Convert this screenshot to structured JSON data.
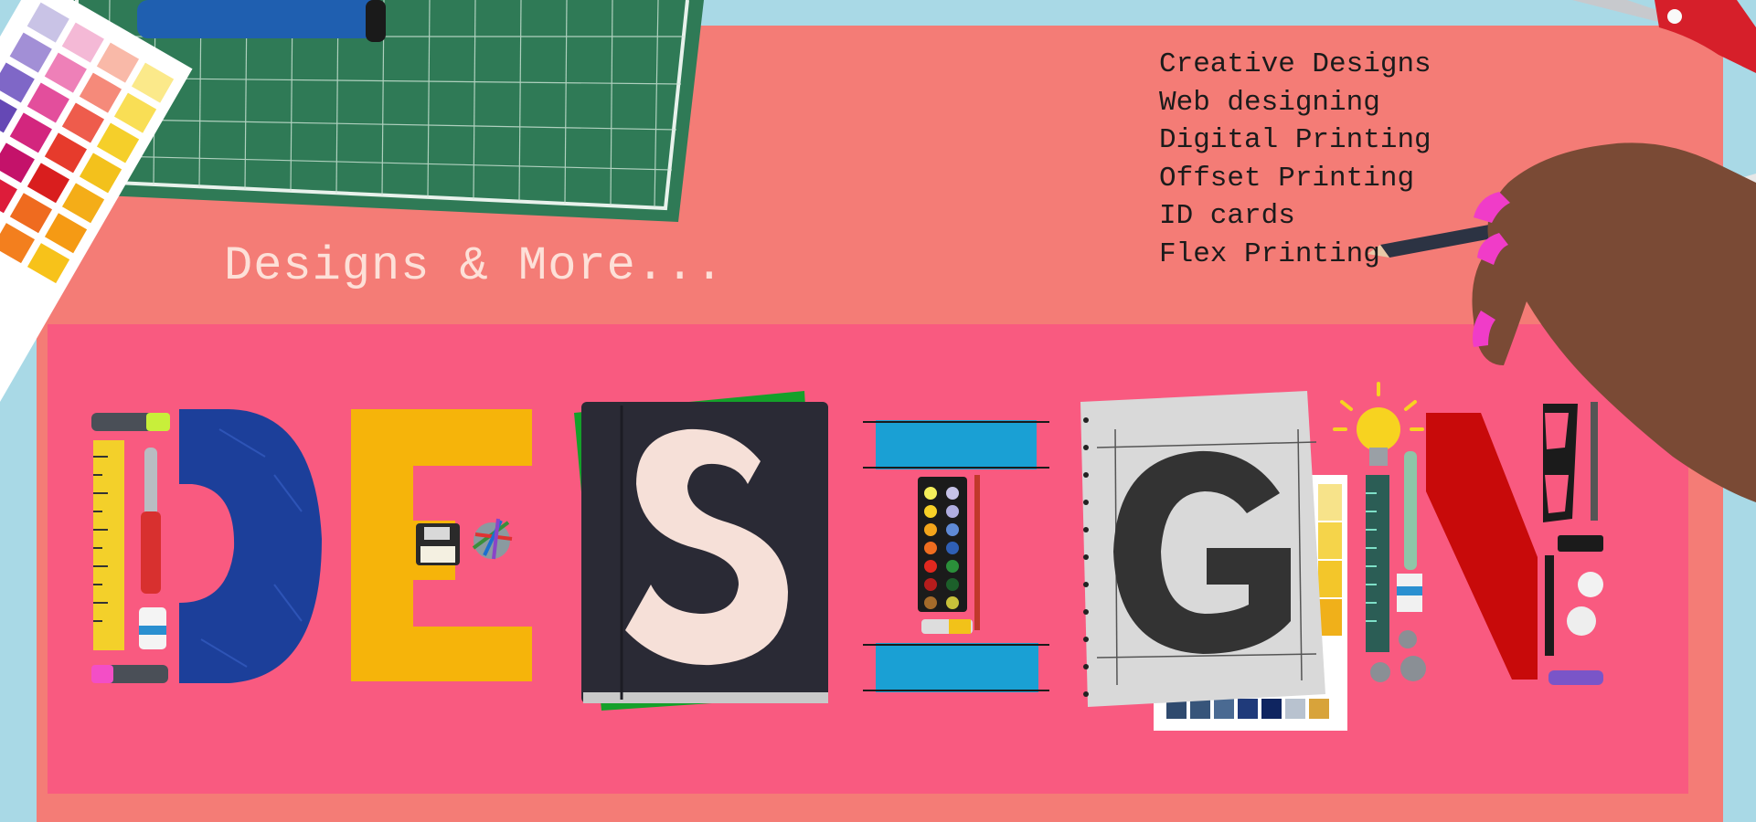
{
  "tagline": "Designs & More...",
  "services": [
    "Creative Designs",
    "Web designing",
    "Digital Printing",
    "Offset Printing",
    "ID cards",
    "Flex Printing"
  ],
  "word_letters": [
    "D",
    "E",
    "S",
    "I",
    "G",
    "N"
  ],
  "colors": {
    "background": "#a9d9e6",
    "banner": "#f47c76",
    "band": "#f95a80",
    "tagline": "#fde0d8",
    "services_text": "#1b1b1b",
    "letter_d": "#1c3f9a",
    "letter_e": "#f6b40a",
    "letter_s": "#f6e0d8",
    "letter_i": "#1aa0d4",
    "letter_g": "#333333",
    "letter_n": "#c80a0a",
    "cutting_mat": "#2f7a56"
  }
}
